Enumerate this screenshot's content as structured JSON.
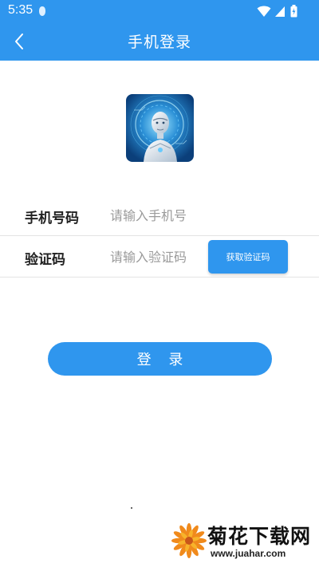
{
  "status_bar": {
    "time": "5:35"
  },
  "nav": {
    "title": "手机登录",
    "back_icon": "chevron-left-icon"
  },
  "logo": {
    "icon": "robot-app-logo"
  },
  "form": {
    "phone": {
      "label": "手机号码",
      "placeholder": "请输入手机号",
      "value": ""
    },
    "code": {
      "label": "验证码",
      "placeholder": "请输入验证码",
      "value": "",
      "button_label": "获取验证码"
    }
  },
  "login_button": {
    "label": "登 录"
  },
  "watermark": {
    "name": "菊花下载网",
    "url": "www.juahar.com"
  },
  "colors": {
    "primary": "#2f96ee",
    "text": "#222222",
    "placeholder": "#9a9a9a",
    "divider": "#e4e4e4"
  }
}
